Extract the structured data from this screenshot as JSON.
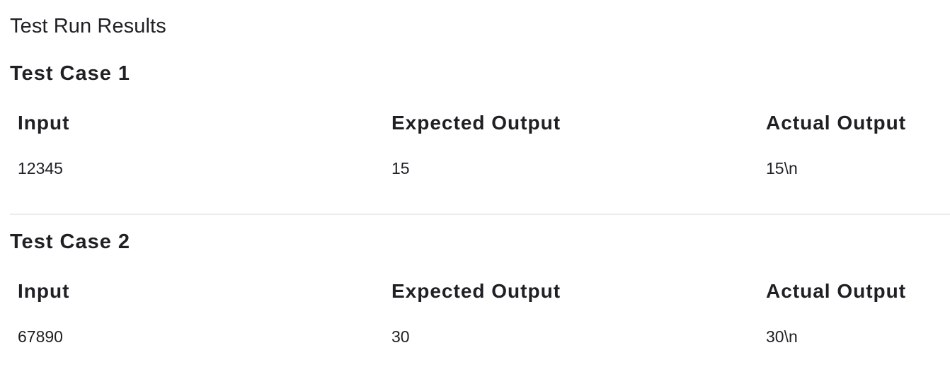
{
  "page": {
    "title": "Test Run Results"
  },
  "test_cases": [
    {
      "title": "Test Case 1",
      "headers": {
        "input": "Input",
        "expected": "Expected Output",
        "actual": "Actual Output"
      },
      "values": {
        "input": "12345",
        "expected": "15",
        "actual": "15\\n"
      }
    },
    {
      "title": "Test Case 2",
      "headers": {
        "input": "Input",
        "expected": "Expected Output",
        "actual": "Actual Output"
      },
      "values": {
        "input": "67890",
        "expected": "30",
        "actual": "30\\n"
      }
    }
  ],
  "colors": {
    "text": "#1f1f24",
    "divider": "#ececef",
    "background": "#ffffff"
  }
}
